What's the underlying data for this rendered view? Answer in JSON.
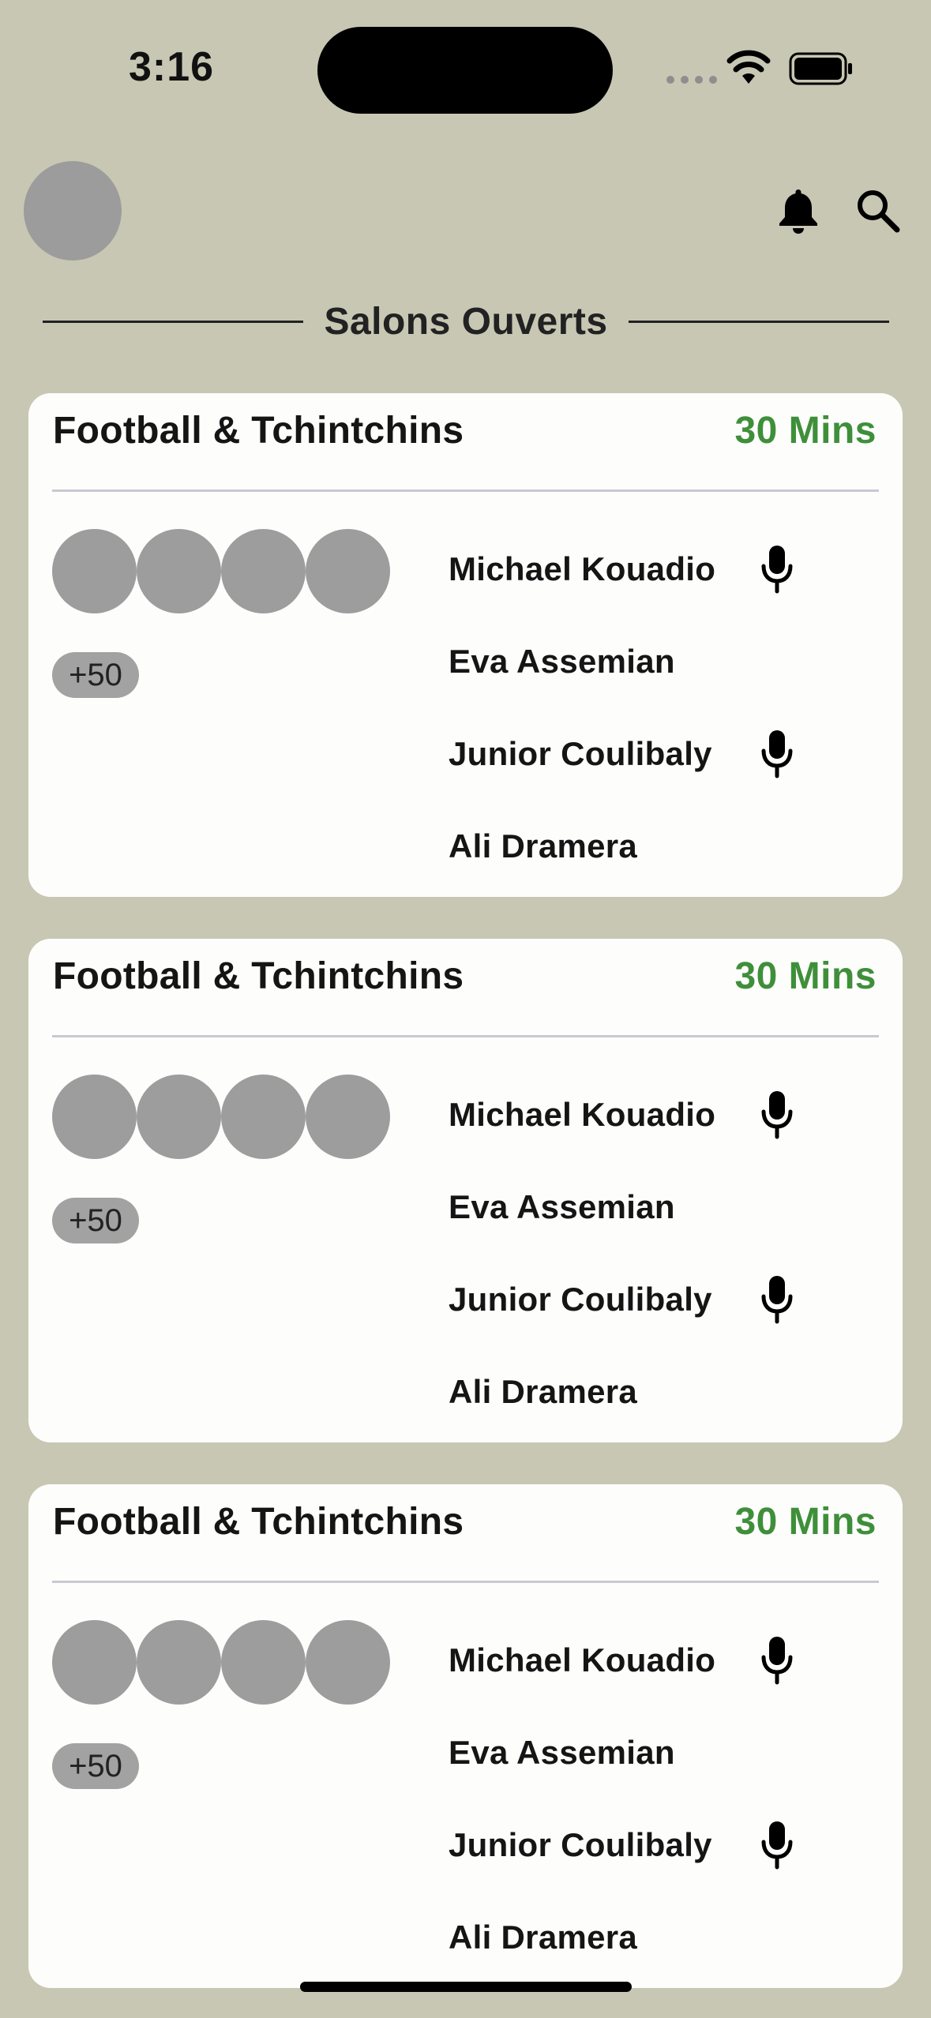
{
  "status_bar": {
    "time": "3:16"
  },
  "header": {
    "icons": [
      "avatar",
      "bell-icon",
      "search-icon"
    ]
  },
  "section": {
    "title": "Salons Ouverts"
  },
  "cards": [
    {
      "title": "Football & Tchintchins",
      "duration": "30 Mins",
      "extra_count": "+50",
      "speakers": [
        {
          "name": "Michael Kouadio",
          "mic": true
        },
        {
          "name": "Eva Assemian",
          "mic": false
        },
        {
          "name": "Junior Coulibaly",
          "mic": true
        },
        {
          "name": "Ali Dramera",
          "mic": false
        }
      ]
    },
    {
      "title": "Football & Tchintchins",
      "duration": "30 Mins",
      "extra_count": "+50",
      "speakers": [
        {
          "name": "Michael Kouadio",
          "mic": true
        },
        {
          "name": "Eva Assemian",
          "mic": false
        },
        {
          "name": "Junior Coulibaly",
          "mic": true
        },
        {
          "name": "Ali Dramera",
          "mic": false
        }
      ]
    },
    {
      "title": "Football & Tchintchins",
      "duration": "30 Mins",
      "extra_count": "+50",
      "speakers": [
        {
          "name": "Michael Kouadio",
          "mic": true
        },
        {
          "name": "Eva Assemian",
          "mic": false
        },
        {
          "name": "Junior Coulibaly",
          "mic": true
        },
        {
          "name": "Ali Dramera",
          "mic": false
        }
      ]
    }
  ],
  "colors": {
    "background": "#c8c7b3",
    "card": "#fdfdfc",
    "accent_green": "#3f8f3a",
    "avatar_gray": "#9d9d9d"
  }
}
